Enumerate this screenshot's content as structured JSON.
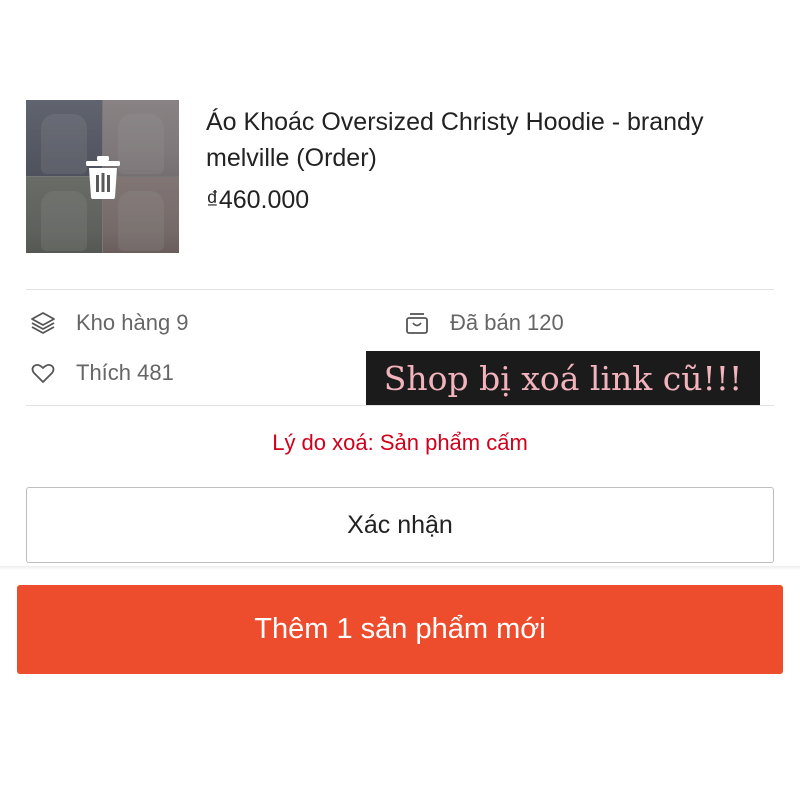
{
  "product": {
    "title": "Áo Khoác Oversized Christy Hoodie - brandy melville (Order)",
    "price": "₫460.000",
    "thumbnail_icon": "trash-icon"
  },
  "stats": {
    "stock": {
      "label": "Kho hàng 9",
      "icon": "stack-icon"
    },
    "sold": {
      "label": "Đã bán 120",
      "icon": "shopping-bag-icon"
    },
    "likes": {
      "label": "Thích 481",
      "icon": "heart-icon"
    }
  },
  "note": {
    "text": "Shop bị xoá link cũ!!!"
  },
  "reason": {
    "text": "Lý do xoá: Sản phẩm cấm"
  },
  "buttons": {
    "confirm": "Xác nhận",
    "add_new": "Thêm 1 sản phẩm mới"
  },
  "colors": {
    "accent": "#ee4d2d",
    "reason_text": "#d0011b",
    "note_bg": "#1b1b1b",
    "note_text": "#f2b3bd"
  }
}
